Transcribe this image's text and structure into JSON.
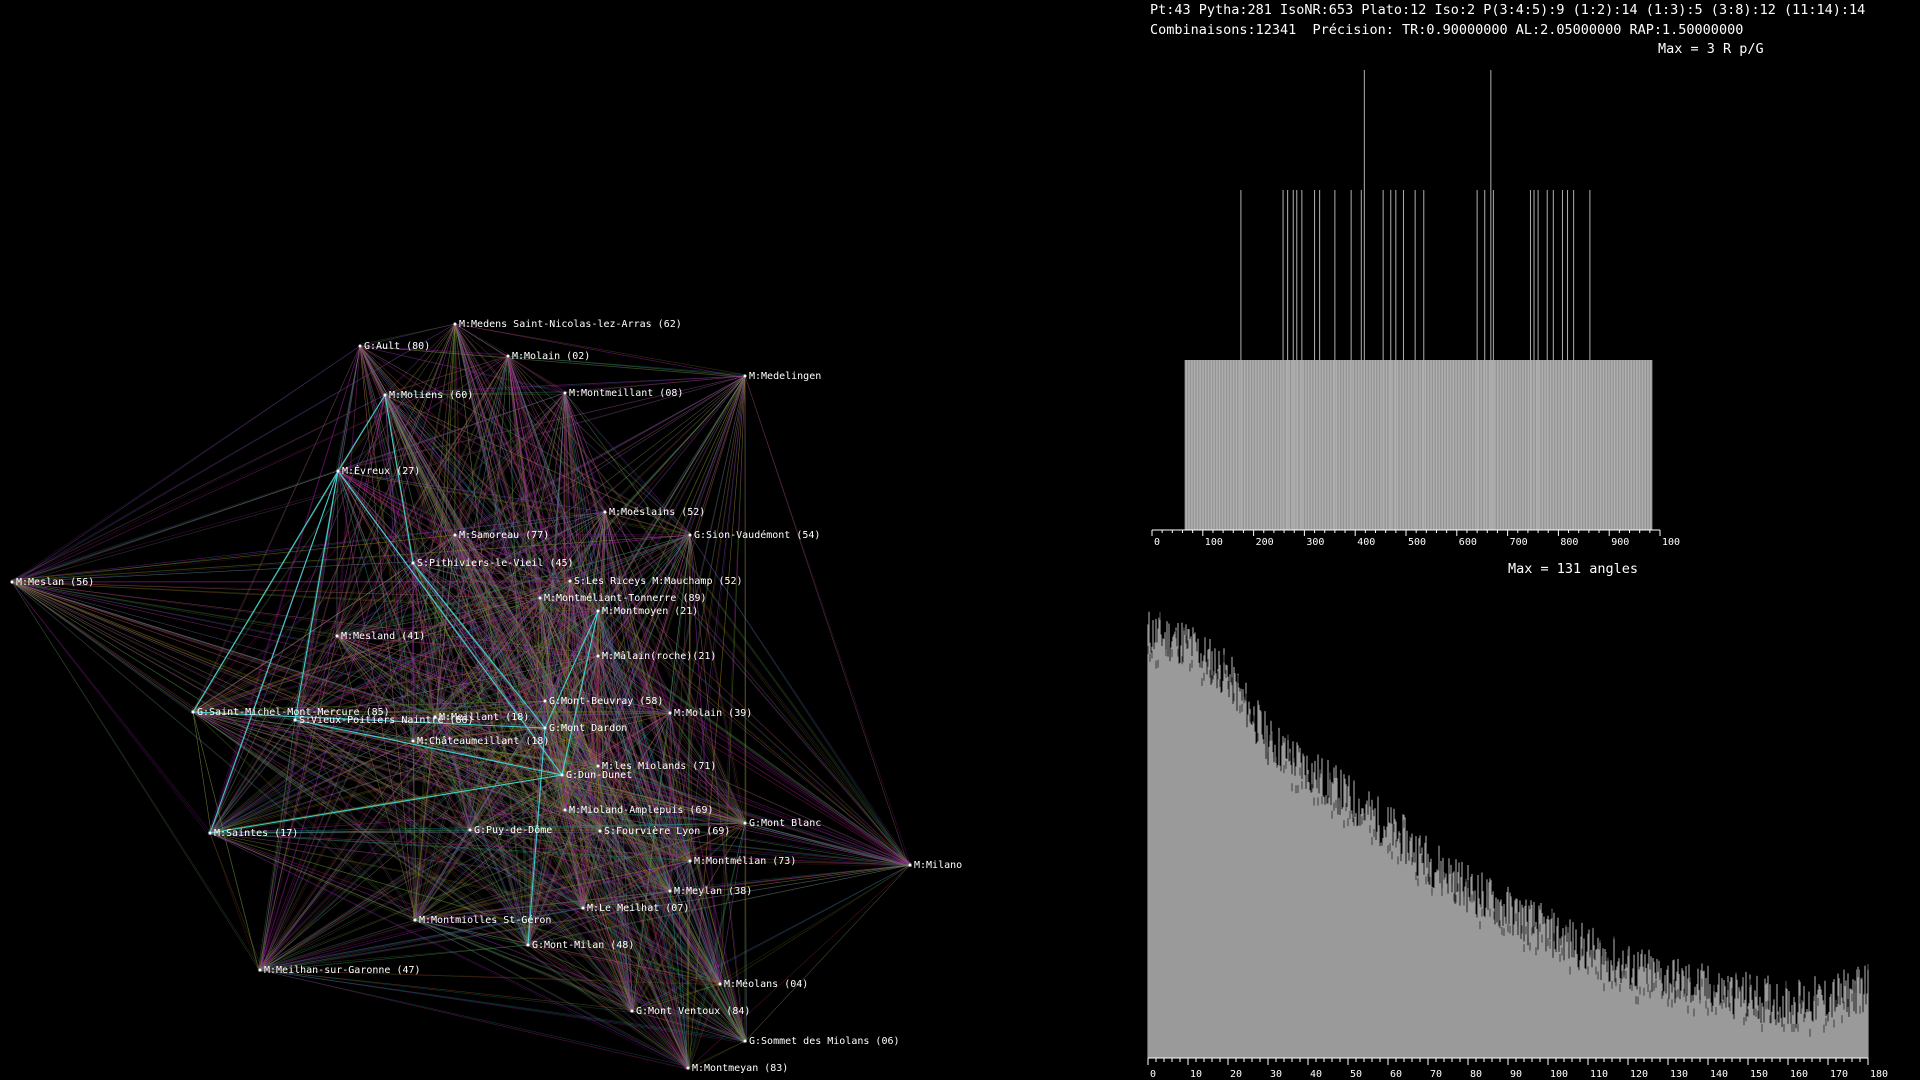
{
  "header": {
    "line1": "Pt:43 Pytha:281 IsoNR:653 Plato:12 Iso:2 P(3:4:5):9 (1:2):14 (1:3):5 (3:8):12 (11:14):14",
    "line2": "Combinaisons:12341  Précision: TR:0.90000000 AL:2.05000000 RAP:1.50000000"
  },
  "nodes": [
    {
      "label": "M:Medens Saint-Nicolas-lez-Arras (62)"
    },
    {
      "label": "G:Ault (80)"
    },
    {
      "label": "M:Molain (02)"
    },
    {
      "label": "M:Medelingen"
    },
    {
      "label": "M:Moliens (60)"
    },
    {
      "label": "M:Montmeillant (08)"
    },
    {
      "label": "M:Évreux (27)"
    },
    {
      "label": "M:Moëslains (52)"
    },
    {
      "label": "M:Samoreau (77)"
    },
    {
      "label": "G:Sion-Vaudémont (54)"
    },
    {
      "label": "M:Meslan (56)"
    },
    {
      "label": "S:Pithiviers-le-Vieil (45)"
    },
    {
      "label": "S:Les Riceys M:Mauchamp (52)"
    },
    {
      "label": "M:Montméliant-Tonnerre (89)"
    },
    {
      "label": "M:Montmoyen (21)"
    },
    {
      "label": "M:Mesland (41)"
    },
    {
      "label": "M:Mâlain(roche)(21)"
    },
    {
      "label": "G:Mont-Beuvray (58)"
    },
    {
      "label": "G:Saint-Michel-Mont-Mercure (85)"
    },
    {
      "label": "M:Meillant (18)"
    },
    {
      "label": "M:Molain (39)"
    },
    {
      "label": "S:Vieux-Poitiers Naintré (86)"
    },
    {
      "label": "G:Mont Dardon"
    },
    {
      "label": "M:Châteaumeillant (18)"
    },
    {
      "label": "M:les Miolands (71)"
    },
    {
      "label": "G:Dun-Dunet"
    },
    {
      "label": "M:Mioland-Amplepuis (69)"
    },
    {
      "label": "G:Mont Blanc"
    },
    {
      "label": "M:Saintes (17)"
    },
    {
      "label": "G:Puy-de-Dôme"
    },
    {
      "label": "S:Fourvière Lyon (69)"
    },
    {
      "label": "M:Montmélian (73)"
    },
    {
      "label": "M:Milano"
    },
    {
      "label": "M:Meylan (38)"
    },
    {
      "label": "M:Le Meilhat (07)"
    },
    {
      "label": "M:Montmiolles St-Géron"
    },
    {
      "label": "G:Mont-Milan (48)"
    },
    {
      "label": "M:Meilhan-sur-Garonne (47)"
    },
    {
      "label": "M:Méolans (04)"
    },
    {
      "label": "G:Mont Ventoux (84)"
    },
    {
      "label": "G:Sommet des Miolans (06)"
    },
    {
      "label": "M:Montmeyan (83)"
    }
  ],
  "colors": {
    "magenta": "#c020c0",
    "teal": "#20a0a0",
    "green": "#60a020",
    "olive": "#a0a020",
    "purple": "#8030a0",
    "red": "#802020",
    "cyan": "#40e0e0",
    "histTop": "#b0b0b0",
    "histBot": "#9a9a9a"
  },
  "chart_data": [
    {
      "type": "bar",
      "title": "Max = 3 R p/G",
      "xlim": [
        0,
        1000
      ],
      "ticks": [
        0,
        100,
        200,
        300,
        400,
        500,
        600,
        700,
        800,
        900,
        1000
      ],
      "ylim": [
        0,
        3
      ],
      "bars": [
        {
          "x": 418,
          "value": 3
        },
        {
          "x": 667,
          "value": 3
        },
        {
          "x": 175,
          "value": 2
        },
        {
          "x": 258,
          "value": 2
        },
        {
          "x": 267,
          "value": 2
        },
        {
          "x": 278,
          "value": 2
        },
        {
          "x": 285,
          "value": 2
        },
        {
          "x": 295,
          "value": 2
        },
        {
          "x": 320,
          "value": 2
        },
        {
          "x": 330,
          "value": 2
        },
        {
          "x": 360,
          "value": 2
        },
        {
          "x": 392,
          "value": 2
        },
        {
          "x": 412,
          "value": 2
        },
        {
          "x": 455,
          "value": 2
        },
        {
          "x": 470,
          "value": 2
        },
        {
          "x": 480,
          "value": 2
        },
        {
          "x": 495,
          "value": 2
        },
        {
          "x": 518,
          "value": 2
        },
        {
          "x": 535,
          "value": 2
        },
        {
          "x": 640,
          "value": 2
        },
        {
          "x": 655,
          "value": 2
        },
        {
          "x": 672,
          "value": 2
        },
        {
          "x": 745,
          "value": 2
        },
        {
          "x": 752,
          "value": 2
        },
        {
          "x": 760,
          "value": 2
        },
        {
          "x": 778,
          "value": 2
        },
        {
          "x": 790,
          "value": 2
        },
        {
          "x": 808,
          "value": 2
        },
        {
          "x": 818,
          "value": 2
        },
        {
          "x": 830,
          "value": 2
        },
        {
          "x": 862,
          "value": 2
        }
      ],
      "baseline_range": [
        65,
        985
      ],
      "baseline_value": 1
    },
    {
      "type": "bar",
      "title": "Max = 131 angles",
      "xlim": [
        0,
        180
      ],
      "ticks": [
        0,
        10,
        20,
        30,
        40,
        50,
        60,
        70,
        80,
        90,
        100,
        110,
        120,
        130,
        140,
        150,
        160,
        170,
        180
      ],
      "ylim": [
        0,
        131
      ],
      "trend": [
        {
          "x": 0,
          "value": 118
        },
        {
          "x": 10,
          "value": 115
        },
        {
          "x": 20,
          "value": 106
        },
        {
          "x": 30,
          "value": 88
        },
        {
          "x": 40,
          "value": 80
        },
        {
          "x": 50,
          "value": 72
        },
        {
          "x": 60,
          "value": 64
        },
        {
          "x": 70,
          "value": 55
        },
        {
          "x": 80,
          "value": 47
        },
        {
          "x": 90,
          "value": 41
        },
        {
          "x": 100,
          "value": 35
        },
        {
          "x": 110,
          "value": 30
        },
        {
          "x": 120,
          "value": 25
        },
        {
          "x": 130,
          "value": 22
        },
        {
          "x": 140,
          "value": 19
        },
        {
          "x": 150,
          "value": 17
        },
        {
          "x": 160,
          "value": 15
        },
        {
          "x": 170,
          "value": 16
        },
        {
          "x": 180,
          "value": 20
        }
      ]
    }
  ]
}
